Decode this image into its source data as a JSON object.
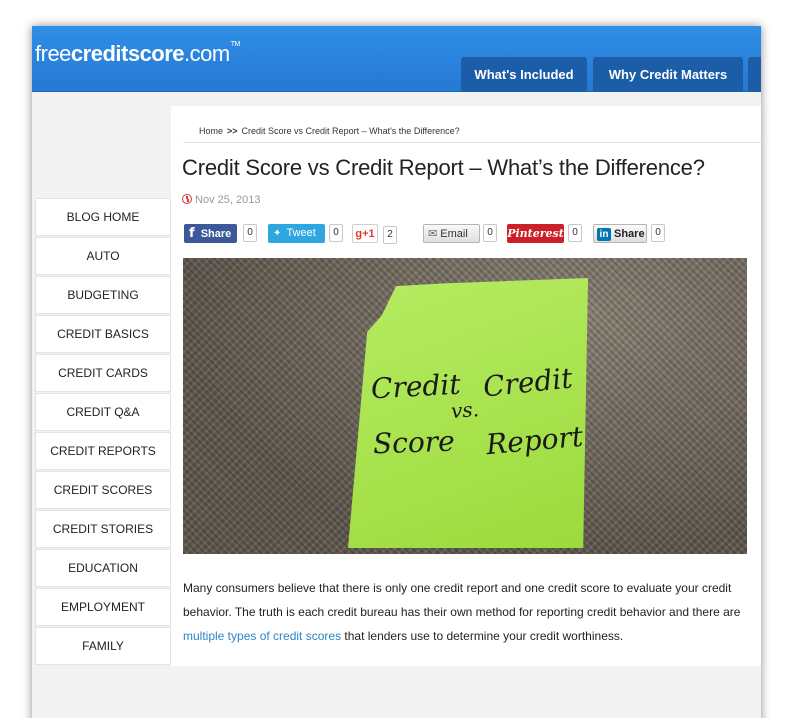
{
  "header": {
    "logo": {
      "pre": "free",
      "mid": "creditscore",
      "post": ".com",
      "tm": "TM"
    },
    "tabs": [
      {
        "label": "What's Included"
      },
      {
        "label": "Why Credit Matters"
      }
    ]
  },
  "breadcrumb": {
    "home": "Home",
    "separator": ">>",
    "current": "Credit Score vs Credit Report – What's the Difference?"
  },
  "article": {
    "title": "Credit Score vs Credit Report – What’s the Difference?",
    "date": "Nov 25, 2013",
    "image_text": {
      "left_top": "Credit",
      "left_bottom": "Score",
      "middle": "vs.",
      "right_top": "Credit",
      "right_bottom": "Report"
    },
    "body_1": "Many consumers believe that there is only one credit report and one credit score to evaluate your credit behavior. The truth is each credit bureau has their own method for reporting credit behavior and there are ",
    "body_link": "multiple types of credit scores",
    "body_2": " that lenders use to determine your credit worthiness."
  },
  "share": {
    "facebook": {
      "label": "Share",
      "icon": "facebook-f-icon",
      "count": "0"
    },
    "twitter": {
      "label": "Tweet",
      "icon": "twitter-bird-icon",
      "count": "0"
    },
    "googleplus": {
      "label": "+1",
      "icon": "google-g-icon",
      "count": "2"
    },
    "email": {
      "label": "Email",
      "icon": "envelope-icon",
      "count": "0"
    },
    "pinterest": {
      "label": "Pinterest",
      "count": "0"
    },
    "linkedin": {
      "label": "Share",
      "icon": "linkedin-in-icon",
      "count": "0"
    }
  },
  "sidebar": {
    "items": [
      {
        "label": "BLOG HOME"
      },
      {
        "label": "AUTO"
      },
      {
        "label": "BUDGETING"
      },
      {
        "label": "CREDIT BASICS"
      },
      {
        "label": "CREDIT CARDS"
      },
      {
        "label": "CREDIT Q&A"
      },
      {
        "label": "CREDIT REPORTS"
      },
      {
        "label": "CREDIT SCORES"
      },
      {
        "label": "CREDIT STORIES"
      },
      {
        "label": "EDUCATION"
      },
      {
        "label": "EMPLOYMENT"
      },
      {
        "label": "FAMILY"
      }
    ]
  },
  "colors": {
    "brand_blue": "#2a83dd",
    "tab_blue": "#1c5da8",
    "link": "#2a86c8",
    "note_green": "#a6e840"
  }
}
